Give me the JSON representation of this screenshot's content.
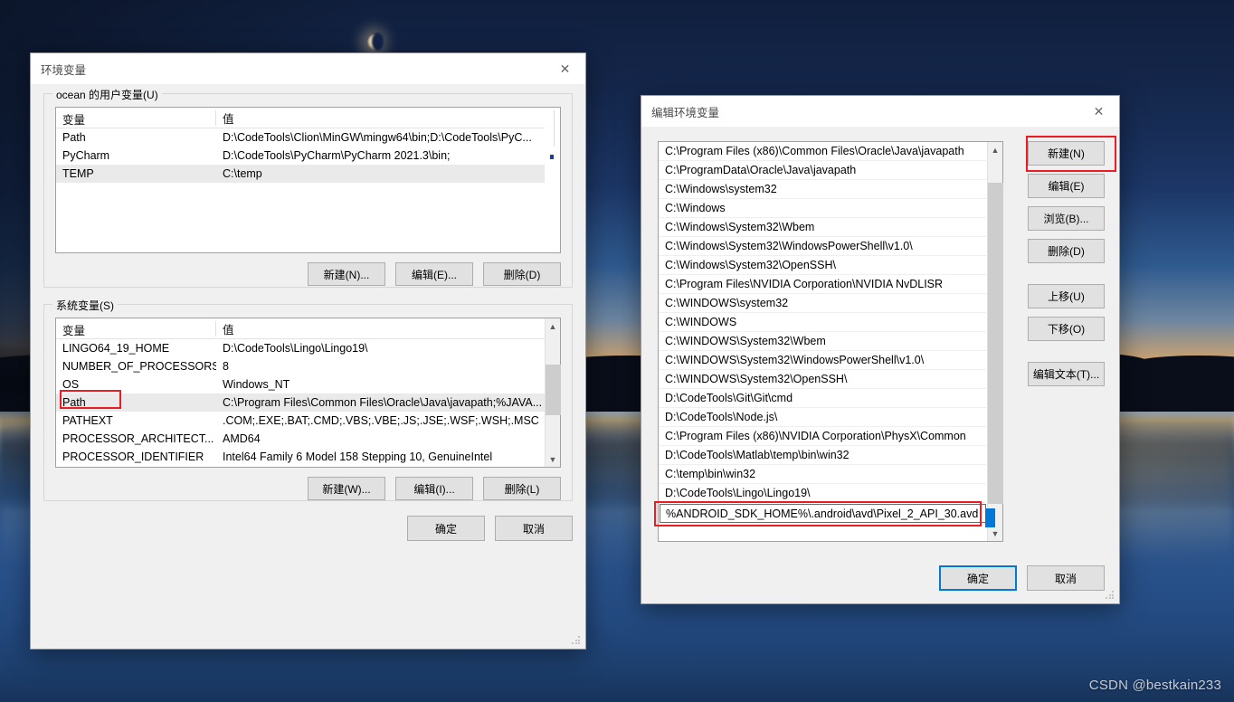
{
  "desktop": {
    "watermark": "CSDN @bestkain233"
  },
  "env_dialog": {
    "title": "环境变量",
    "close_icon": "close-icon",
    "user_group_label": "ocean 的用户变量(U)",
    "system_group_label": "系统变量(S)",
    "columns": {
      "variable": "变量",
      "value": "值"
    },
    "user_vars": [
      {
        "name": "Path",
        "value": "D:\\CodeTools\\Clion\\MinGW\\mingw64\\bin;D:\\CodeTools\\PyC...",
        "selected": false
      },
      {
        "name": "PyCharm",
        "value": "D:\\CodeTools\\PyCharm\\PyCharm 2021.3\\bin;",
        "selected": false
      },
      {
        "name": "TEMP",
        "value": "C:\\temp",
        "selected": true
      }
    ],
    "user_buttons": [
      {
        "label": "新建(N)..."
      },
      {
        "label": "编辑(E)..."
      },
      {
        "label": "删除(D)"
      }
    ],
    "system_vars": [
      {
        "name": "LINGO64_19_HOME",
        "value": "D:\\CodeTools\\Lingo\\Lingo19\\",
        "highlight": false
      },
      {
        "name": "NUMBER_OF_PROCESSORS",
        "value": "8",
        "highlight": false
      },
      {
        "name": "OS",
        "value": "Windows_NT",
        "highlight": false
      },
      {
        "name": "Path",
        "value": "C:\\Program Files\\Common Files\\Oracle\\Java\\javapath;%JAVA...",
        "highlight": true
      },
      {
        "name": "PATHEXT",
        "value": ".COM;.EXE;.BAT;.CMD;.VBS;.VBE;.JS;.JSE;.WSF;.WSH;.MSC",
        "highlight": false
      },
      {
        "name": "PROCESSOR_ARCHITECT...",
        "value": "AMD64",
        "highlight": false
      },
      {
        "name": "PROCESSOR_IDENTIFIER",
        "value": "Intel64 Family 6 Model 158 Stepping 10, GenuineIntel",
        "highlight": false
      }
    ],
    "system_buttons": [
      {
        "label": "新建(W)..."
      },
      {
        "label": "编辑(I)..."
      },
      {
        "label": "删除(L)"
      }
    ],
    "footer_buttons": [
      {
        "label": "确定",
        "default": false
      },
      {
        "label": "取消",
        "default": false
      }
    ]
  },
  "edit_dialog": {
    "title": "编辑环境变量",
    "close_icon": "close-icon",
    "paths": [
      "C:\\Program Files (x86)\\Common Files\\Oracle\\Java\\javapath",
      "C:\\ProgramData\\Oracle\\Java\\javapath",
      "C:\\Windows\\system32",
      "C:\\Windows",
      "C:\\Windows\\System32\\Wbem",
      "C:\\Windows\\System32\\WindowsPowerShell\\v1.0\\",
      "C:\\Windows\\System32\\OpenSSH\\",
      "C:\\Program Files\\NVIDIA Corporation\\NVIDIA NvDLISR",
      "C:\\WINDOWS\\system32",
      "C:\\WINDOWS",
      "C:\\WINDOWS\\System32\\Wbem",
      "C:\\WINDOWS\\System32\\WindowsPowerShell\\v1.0\\",
      "C:\\WINDOWS\\System32\\OpenSSH\\",
      "D:\\CodeTools\\Git\\Git\\cmd",
      "D:\\CodeTools\\Node.js\\",
      "C:\\Program Files (x86)\\NVIDIA Corporation\\PhysX\\Common",
      "D:\\CodeTools\\Matlab\\temp\\bin\\win32",
      "C:\\temp\\bin\\win32",
      "D:\\CodeTools\\Lingo\\Lingo19\\"
    ],
    "editing_value": "%ANDROID_SDK_HOME%\\.android\\avd\\Pixel_2_API_30.avd",
    "side_buttons": [
      {
        "label": "新建(N)",
        "highlighted": true
      },
      {
        "label": "编辑(E)",
        "highlighted": false
      },
      {
        "label": "浏览(B)...",
        "highlighted": false
      },
      {
        "label": "删除(D)",
        "highlighted": false
      },
      {
        "label": "上移(U)",
        "highlighted": false
      },
      {
        "label": "下移(O)",
        "highlighted": false
      },
      {
        "label": "编辑文本(T)...",
        "highlighted": false
      }
    ],
    "footer_buttons": [
      {
        "label": "确定",
        "default": true
      },
      {
        "label": "取消",
        "default": false
      }
    ]
  },
  "colors": {
    "accent": "#0078d7",
    "annotation": "#ec1c24",
    "dialog_bg": "#f0f0f0",
    "selection": "#0078d7"
  }
}
